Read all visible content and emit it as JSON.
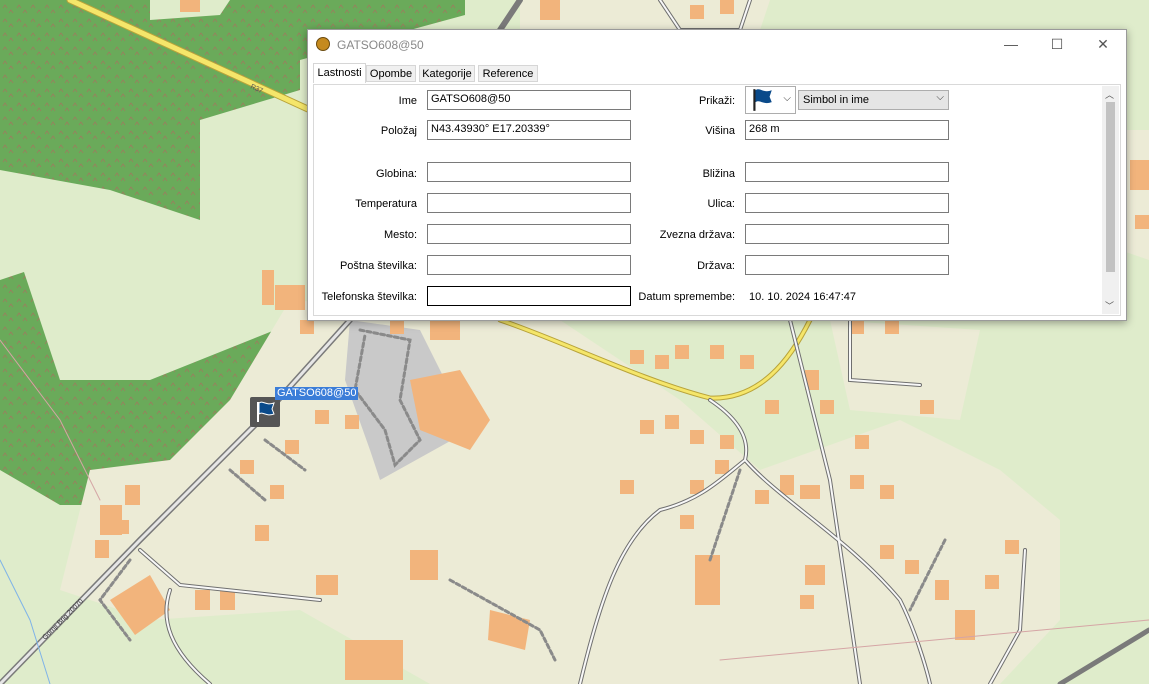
{
  "window": {
    "title": "GATSO608@50",
    "minimize": "—",
    "maximize": "☐",
    "close": "✕"
  },
  "tabs": [
    "Lastnosti",
    "Opombe",
    "Kategorije",
    "Reference"
  ],
  "fields": {
    "ime": {
      "label": "Ime",
      "value": "GATSO608@50"
    },
    "polozaj": {
      "label": "Položaj",
      "value": "N43.43930° E17.20339°"
    },
    "prikazi": {
      "label": "Prikaži:",
      "symbol_icon": "blue-flag-icon",
      "option": "Simbol in ime"
    },
    "visina": {
      "label": "Višina",
      "value": "268 m"
    },
    "globina": {
      "label": "Globina:",
      "value": ""
    },
    "blizina": {
      "label": "Bližina",
      "value": ""
    },
    "temperatura": {
      "label": "Temperatura",
      "value": ""
    },
    "ulica": {
      "label": "Ulica:",
      "value": ""
    },
    "mesto": {
      "label": "Mesto:",
      "value": ""
    },
    "zvezna_drzava": {
      "label": "Zvezna država:",
      "value": ""
    },
    "postna": {
      "label": "Poštna številka:",
      "value": ""
    },
    "drzava": {
      "label": "Država:",
      "value": ""
    },
    "telefon": {
      "label": "Telefonska številka:",
      "value": ""
    },
    "datum": {
      "label": "Datum spremembe:",
      "value": "10. 10. 2024 16:47:47"
    }
  },
  "map": {
    "waypoint_label": "GATSO608@50",
    "waypoint_icon": "blue-flag-icon",
    "road_label_1": "R37",
    "road_label_2": "Gornji Brig 20070"
  },
  "colors": {
    "flag": "#0a4a8a",
    "label_bg": "#3b7dd8",
    "forest": "#6aaa5a",
    "built": "#ecebd6",
    "building": "#f2b47c",
    "main_road": "#f5e66a"
  }
}
